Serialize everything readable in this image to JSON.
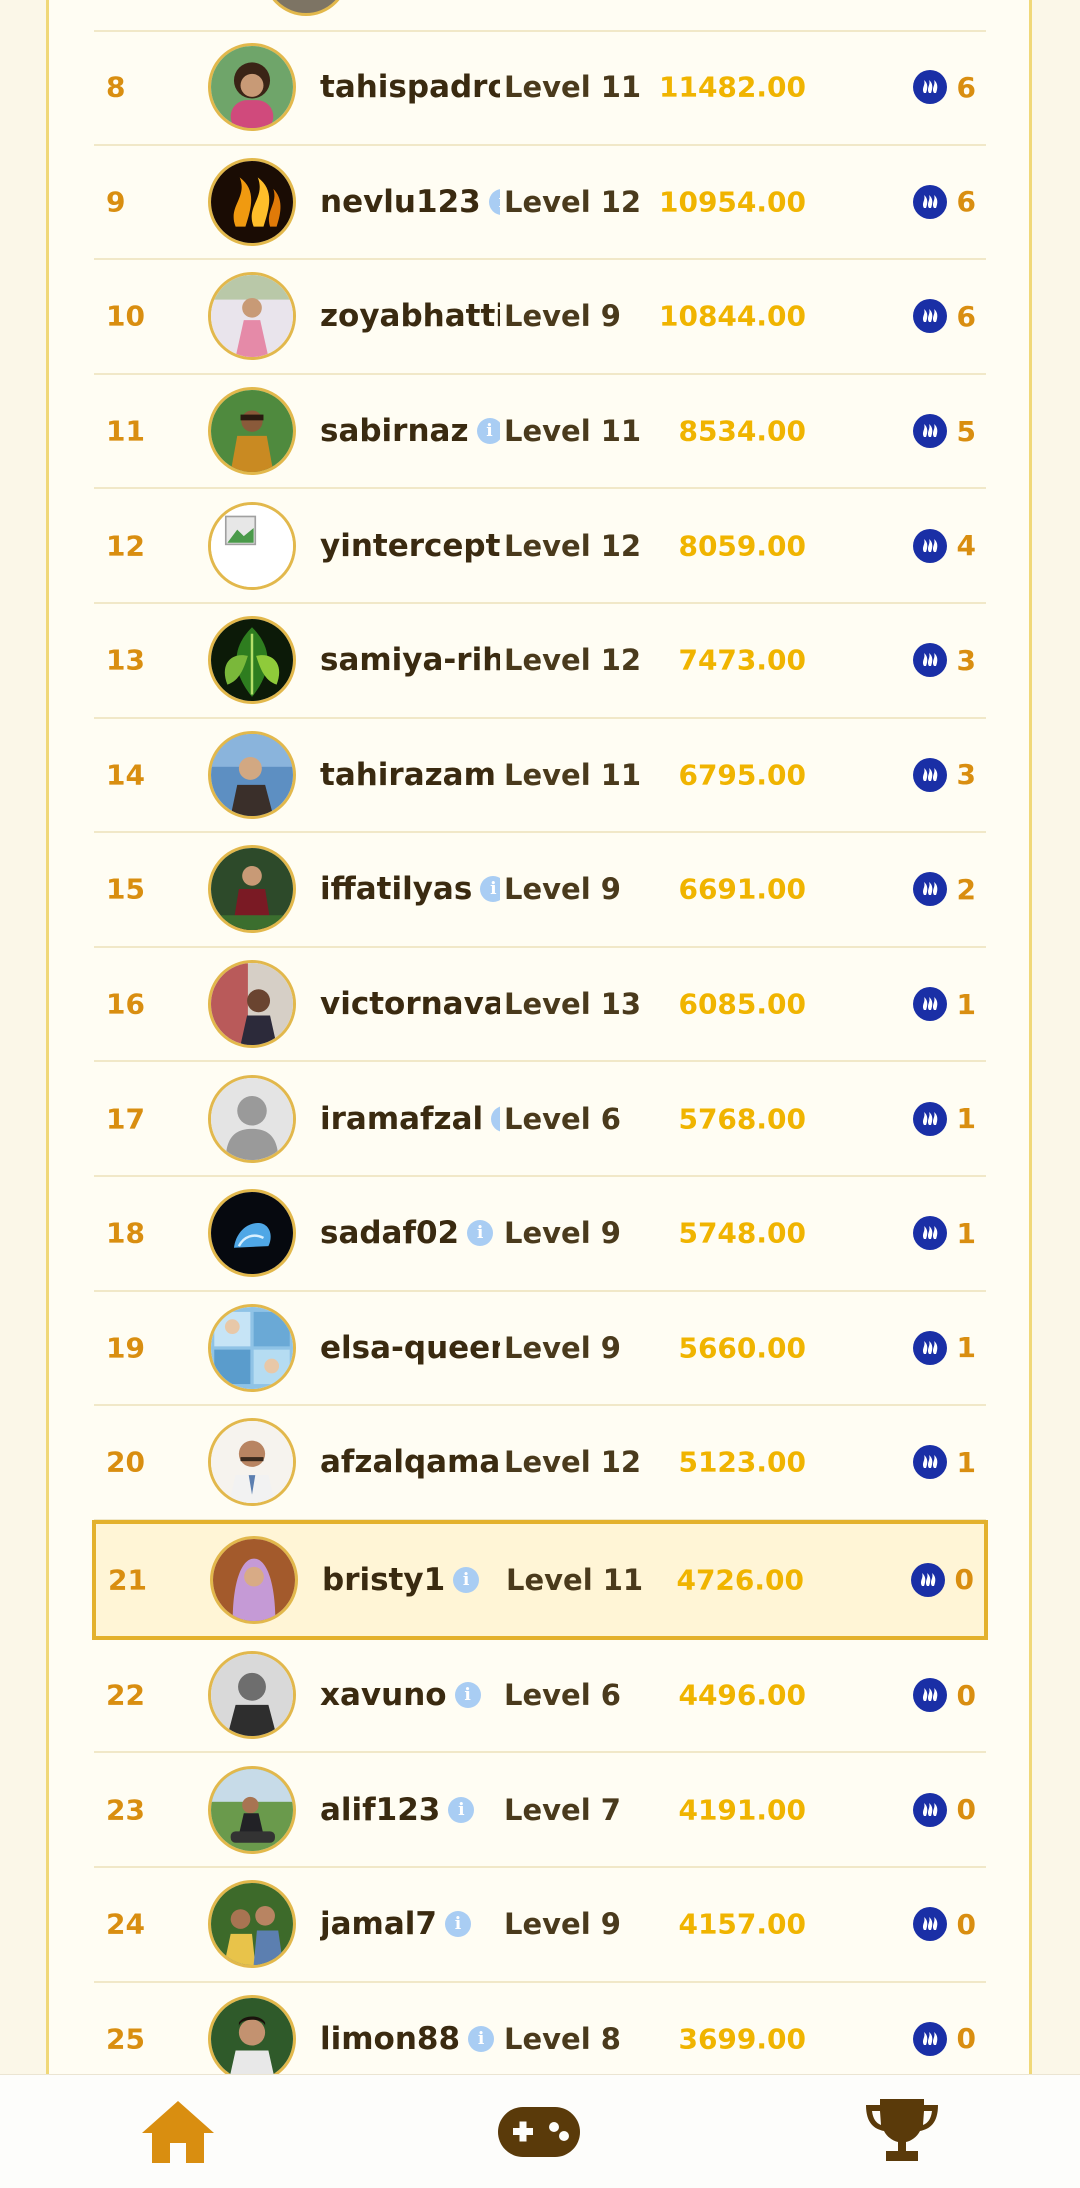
{
  "leaderboard": {
    "rows": [
      {
        "rank": "8",
        "name": "tahispadro",
        "level": "Level 11",
        "points": "11482.00",
        "reward": "6",
        "info": false,
        "avatar": "photo-girl",
        "highlight": false
      },
      {
        "rank": "9",
        "name": "nevlu123",
        "level": "Level 12",
        "points": "10954.00",
        "reward": "6",
        "info": true,
        "avatar": "steem-flame",
        "highlight": false
      },
      {
        "rank": "10",
        "name": "zoyabhatti",
        "level": "Level 9",
        "points": "10844.00",
        "reward": "6",
        "info": false,
        "avatar": "photo-pink",
        "highlight": false
      },
      {
        "rank": "11",
        "name": "sabirnaz",
        "level": "Level 11",
        "points": "8534.00",
        "reward": "5",
        "info": true,
        "avatar": "photo-boy-green",
        "highlight": false
      },
      {
        "rank": "12",
        "name": "yintercept",
        "level": "Level 12",
        "points": "8059.00",
        "reward": "4",
        "info": false,
        "avatar": "broken-image",
        "highlight": false
      },
      {
        "rank": "13",
        "name": "samiya-rih",
        "level": "Level 12",
        "points": "7473.00",
        "reward": "3",
        "info": false,
        "avatar": "leaves",
        "highlight": false
      },
      {
        "rank": "14",
        "name": "tahirazam",
        "level": "Level 11",
        "points": "6795.00",
        "reward": "3",
        "info": false,
        "avatar": "photo-blue",
        "highlight": false
      },
      {
        "rank": "15",
        "name": "iffatilyas",
        "level": "Level 9",
        "points": "6691.00",
        "reward": "2",
        "info": true,
        "avatar": "photo-maroon",
        "highlight": false
      },
      {
        "rank": "16",
        "name": "victornava",
        "level": "Level 13",
        "points": "6085.00",
        "reward": "1",
        "info": false,
        "avatar": "photo-red",
        "highlight": false
      },
      {
        "rank": "17",
        "name": "iramafzal",
        "level": "Level 6",
        "points": "5768.00",
        "reward": "1",
        "info": true,
        "avatar": "default-person",
        "highlight": false
      },
      {
        "rank": "18",
        "name": "sadaf02",
        "level": "Level 9",
        "points": "5748.00",
        "reward": "1",
        "info": true,
        "avatar": "dark-blue",
        "highlight": false
      },
      {
        "rank": "19",
        "name": "elsa-queen",
        "level": "Level 9",
        "points": "5660.00",
        "reward": "1",
        "info": false,
        "avatar": "photo-collage",
        "highlight": false
      },
      {
        "rank": "20",
        "name": "afzalqamar",
        "level": "Level 12",
        "points": "5123.00",
        "reward": "1",
        "info": false,
        "avatar": "photo-man",
        "highlight": false
      },
      {
        "rank": "21",
        "name": "bristy1",
        "level": "Level 11",
        "points": "4726.00",
        "reward": "0",
        "info": true,
        "avatar": "photo-hijab",
        "highlight": true
      },
      {
        "rank": "22",
        "name": "xavuno",
        "level": "Level 6",
        "points": "4496.00",
        "reward": "0",
        "info": true,
        "avatar": "photo-bw",
        "highlight": false
      },
      {
        "rank": "23",
        "name": "alif123",
        "level": "Level 7",
        "points": "4191.00",
        "reward": "0",
        "info": true,
        "avatar": "photo-park",
        "highlight": false
      },
      {
        "rank": "24",
        "name": "jamal7",
        "level": "Level 9",
        "points": "4157.00",
        "reward": "0",
        "info": true,
        "avatar": "photo-family",
        "highlight": false
      },
      {
        "rank": "25",
        "name": "limon88",
        "level": "Level 8",
        "points": "3699.00",
        "reward": "0",
        "info": true,
        "avatar": "photo-young-man",
        "highlight": false
      }
    ]
  },
  "bottom_nav": {
    "items": [
      {
        "id": "home",
        "icon": "home-icon"
      },
      {
        "id": "games",
        "icon": "gamepad-icon"
      },
      {
        "id": "leaderboard",
        "icon": "trophy-icon"
      }
    ]
  },
  "colors": {
    "accent": "#e3b12d",
    "rank": "#d98e10",
    "points": "#f0b400",
    "steem": "#1a2fa6",
    "nav": "#5a3a0a",
    "nav_active": "#d98e10"
  }
}
